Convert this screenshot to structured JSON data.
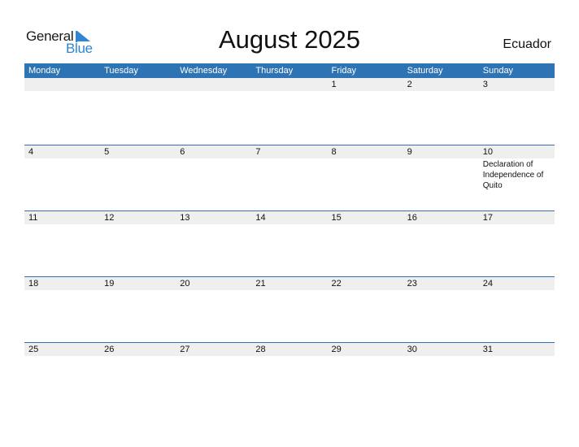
{
  "logo": {
    "general": "General",
    "blue": "Blue"
  },
  "title": "August 2025",
  "country": "Ecuador",
  "weekdays": [
    "Monday",
    "Tuesday",
    "Wednesday",
    "Thursday",
    "Friday",
    "Saturday",
    "Sunday"
  ],
  "weeks": [
    {
      "days": [
        "",
        "",
        "",
        "",
        "1",
        "2",
        "3"
      ],
      "events": [
        "",
        "",
        "",
        "",
        "",
        "",
        ""
      ]
    },
    {
      "days": [
        "4",
        "5",
        "6",
        "7",
        "8",
        "9",
        "10"
      ],
      "events": [
        "",
        "",
        "",
        "",
        "",
        "",
        "Declaration of Independence of Quito"
      ]
    },
    {
      "days": [
        "11",
        "12",
        "13",
        "14",
        "15",
        "16",
        "17"
      ],
      "events": [
        "",
        "",
        "",
        "",
        "",
        "",
        ""
      ]
    },
    {
      "days": [
        "18",
        "19",
        "20",
        "21",
        "22",
        "23",
        "24"
      ],
      "events": [
        "",
        "",
        "",
        "",
        "",
        "",
        ""
      ]
    },
    {
      "days": [
        "25",
        "26",
        "27",
        "28",
        "29",
        "30",
        "31"
      ],
      "events": [
        "",
        "",
        "",
        "",
        "",
        "",
        ""
      ]
    }
  ],
  "colors": {
    "header": "#2e73b3",
    "logo_blue": "#2e86d4",
    "date_strip": "#efefef"
  }
}
